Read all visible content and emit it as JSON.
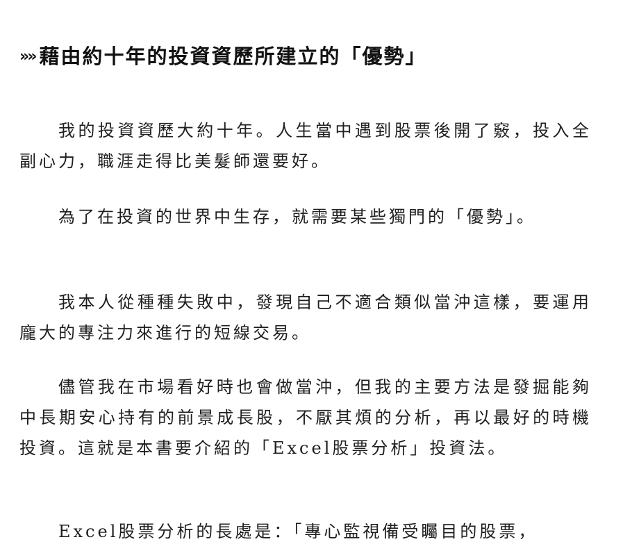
{
  "heading": {
    "marker": "»»",
    "title": "藉由約十年的投資資歷所建立的「優勢」"
  },
  "paragraphs": [
    "我的投資資歷大約十年。人生當中遇到股票後開了竅，投入全副心力，職涯走得比美髮師還要好。",
    "為了在投資的世界中生存，就需要某些獨門的「優勢」。",
    "我本人從種種失敗中，發現自己不適合類似當沖這樣，要運用龐大的專注力來進行的短線交易。",
    "儘管我在市場看好時也會做當沖，但我的主要方法是發掘能夠中長期安心持有的前景成長股，不厭其煩的分析，再以最好的時機投資。這就是本書要介紹的「Excel股票分析」投資法。",
    "Excel股票分析的長處是：「專心監視備受矚目的股票，"
  ]
}
